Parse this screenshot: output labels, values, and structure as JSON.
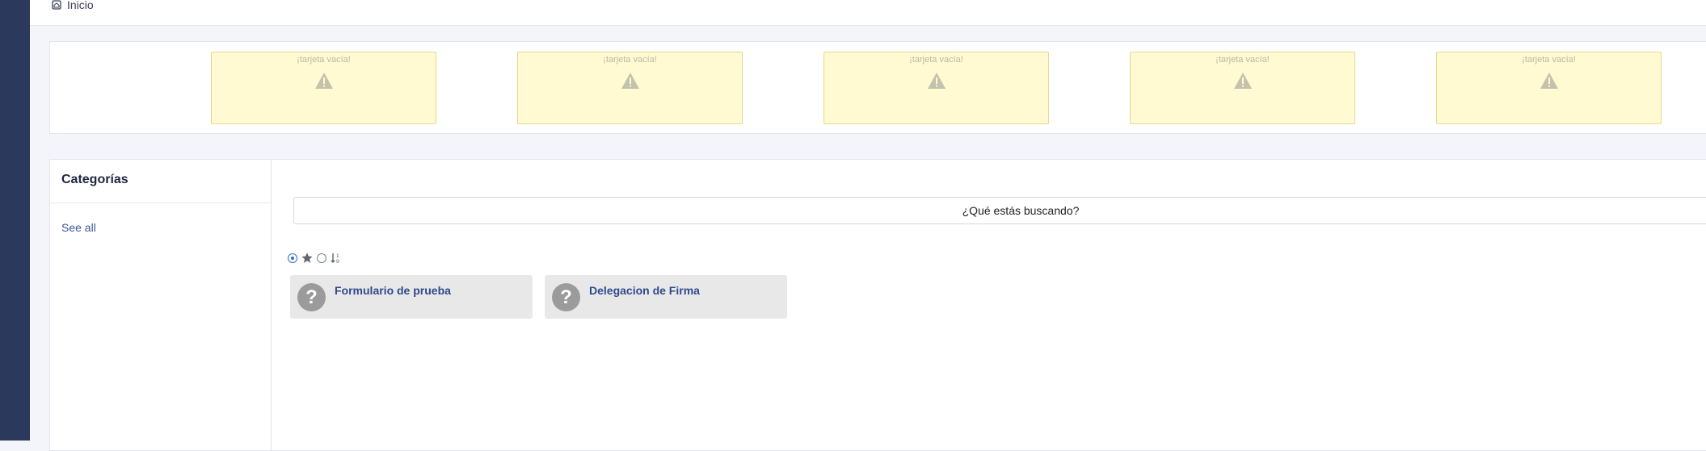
{
  "breadcrumb": {
    "home_label": "Inicio",
    "icon": "home-icon"
  },
  "empty_cards": [
    {
      "label": "¡tarjeta vacía!",
      "icon": "warning-icon"
    },
    {
      "label": "¡tarjeta vacía!",
      "icon": "warning-icon"
    },
    {
      "label": "¡tarjeta vacía!",
      "icon": "warning-icon"
    },
    {
      "label": "¡tarjeta vacía!",
      "icon": "warning-icon"
    },
    {
      "label": "¡tarjeta vacía!",
      "icon": "warning-icon"
    }
  ],
  "categories": {
    "title": "Categorías",
    "see_all": "See all"
  },
  "search": {
    "placeholder": "¿Qué estás buscando?"
  },
  "filters": {
    "selected": "all",
    "options": [
      {
        "name": "all",
        "icon": "radio-selected"
      },
      {
        "name": "favorites",
        "icon": "star-icon"
      },
      {
        "name": "other",
        "icon": "radio-unselected"
      },
      {
        "name": "sort",
        "icon": "sort-icon"
      }
    ]
  },
  "forms": [
    {
      "title": "Formulario de prueba",
      "icon": "question-icon"
    },
    {
      "title": "Delegacion de Firma",
      "icon": "question-icon"
    }
  ],
  "colors": {
    "sidebar": "#2b3a5c",
    "empty_card_bg": "#fffad1",
    "link": "#3b5a9a",
    "form_title": "#2f4b8c",
    "radio_accent": "#2d6fd1"
  }
}
